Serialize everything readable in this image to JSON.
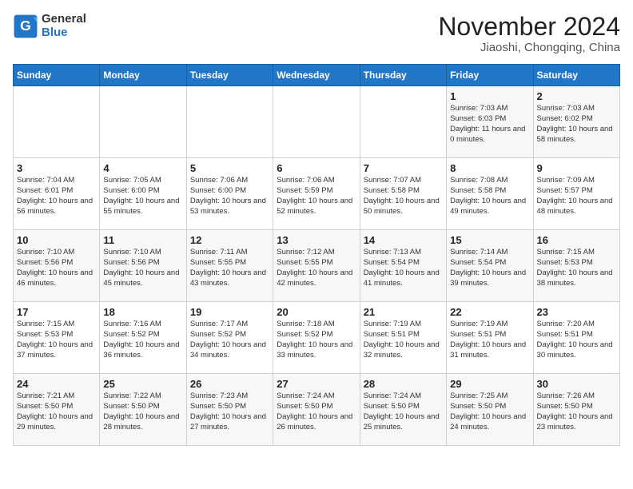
{
  "header": {
    "logo_general": "General",
    "logo_blue": "Blue",
    "month_year": "November 2024",
    "location": "Jiaoshi, Chongqing, China"
  },
  "weekdays": [
    "Sunday",
    "Monday",
    "Tuesday",
    "Wednesday",
    "Thursday",
    "Friday",
    "Saturday"
  ],
  "weeks": [
    [
      {
        "day": "",
        "text": ""
      },
      {
        "day": "",
        "text": ""
      },
      {
        "day": "",
        "text": ""
      },
      {
        "day": "",
        "text": ""
      },
      {
        "day": "",
        "text": ""
      },
      {
        "day": "1",
        "text": "Sunrise: 7:03 AM\nSunset: 6:03 PM\nDaylight: 11 hours and 0 minutes."
      },
      {
        "day": "2",
        "text": "Sunrise: 7:03 AM\nSunset: 6:02 PM\nDaylight: 10 hours and 58 minutes."
      }
    ],
    [
      {
        "day": "3",
        "text": "Sunrise: 7:04 AM\nSunset: 6:01 PM\nDaylight: 10 hours and 56 minutes."
      },
      {
        "day": "4",
        "text": "Sunrise: 7:05 AM\nSunset: 6:00 PM\nDaylight: 10 hours and 55 minutes."
      },
      {
        "day": "5",
        "text": "Sunrise: 7:06 AM\nSunset: 6:00 PM\nDaylight: 10 hours and 53 minutes."
      },
      {
        "day": "6",
        "text": "Sunrise: 7:06 AM\nSunset: 5:59 PM\nDaylight: 10 hours and 52 minutes."
      },
      {
        "day": "7",
        "text": "Sunrise: 7:07 AM\nSunset: 5:58 PM\nDaylight: 10 hours and 50 minutes."
      },
      {
        "day": "8",
        "text": "Sunrise: 7:08 AM\nSunset: 5:58 PM\nDaylight: 10 hours and 49 minutes."
      },
      {
        "day": "9",
        "text": "Sunrise: 7:09 AM\nSunset: 5:57 PM\nDaylight: 10 hours and 48 minutes."
      }
    ],
    [
      {
        "day": "10",
        "text": "Sunrise: 7:10 AM\nSunset: 5:56 PM\nDaylight: 10 hours and 46 minutes."
      },
      {
        "day": "11",
        "text": "Sunrise: 7:10 AM\nSunset: 5:56 PM\nDaylight: 10 hours and 45 minutes."
      },
      {
        "day": "12",
        "text": "Sunrise: 7:11 AM\nSunset: 5:55 PM\nDaylight: 10 hours and 43 minutes."
      },
      {
        "day": "13",
        "text": "Sunrise: 7:12 AM\nSunset: 5:55 PM\nDaylight: 10 hours and 42 minutes."
      },
      {
        "day": "14",
        "text": "Sunrise: 7:13 AM\nSunset: 5:54 PM\nDaylight: 10 hours and 41 minutes."
      },
      {
        "day": "15",
        "text": "Sunrise: 7:14 AM\nSunset: 5:54 PM\nDaylight: 10 hours and 39 minutes."
      },
      {
        "day": "16",
        "text": "Sunrise: 7:15 AM\nSunset: 5:53 PM\nDaylight: 10 hours and 38 minutes."
      }
    ],
    [
      {
        "day": "17",
        "text": "Sunrise: 7:15 AM\nSunset: 5:53 PM\nDaylight: 10 hours and 37 minutes."
      },
      {
        "day": "18",
        "text": "Sunrise: 7:16 AM\nSunset: 5:52 PM\nDaylight: 10 hours and 36 minutes."
      },
      {
        "day": "19",
        "text": "Sunrise: 7:17 AM\nSunset: 5:52 PM\nDaylight: 10 hours and 34 minutes."
      },
      {
        "day": "20",
        "text": "Sunrise: 7:18 AM\nSunset: 5:52 PM\nDaylight: 10 hours and 33 minutes."
      },
      {
        "day": "21",
        "text": "Sunrise: 7:19 AM\nSunset: 5:51 PM\nDaylight: 10 hours and 32 minutes."
      },
      {
        "day": "22",
        "text": "Sunrise: 7:19 AM\nSunset: 5:51 PM\nDaylight: 10 hours and 31 minutes."
      },
      {
        "day": "23",
        "text": "Sunrise: 7:20 AM\nSunset: 5:51 PM\nDaylight: 10 hours and 30 minutes."
      }
    ],
    [
      {
        "day": "24",
        "text": "Sunrise: 7:21 AM\nSunset: 5:50 PM\nDaylight: 10 hours and 29 minutes."
      },
      {
        "day": "25",
        "text": "Sunrise: 7:22 AM\nSunset: 5:50 PM\nDaylight: 10 hours and 28 minutes."
      },
      {
        "day": "26",
        "text": "Sunrise: 7:23 AM\nSunset: 5:50 PM\nDaylight: 10 hours and 27 minutes."
      },
      {
        "day": "27",
        "text": "Sunrise: 7:24 AM\nSunset: 5:50 PM\nDaylight: 10 hours and 26 minutes."
      },
      {
        "day": "28",
        "text": "Sunrise: 7:24 AM\nSunset: 5:50 PM\nDaylight: 10 hours and 25 minutes."
      },
      {
        "day": "29",
        "text": "Sunrise: 7:25 AM\nSunset: 5:50 PM\nDaylight: 10 hours and 24 minutes."
      },
      {
        "day": "30",
        "text": "Sunrise: 7:26 AM\nSunset: 5:50 PM\nDaylight: 10 hours and 23 minutes."
      }
    ]
  ]
}
